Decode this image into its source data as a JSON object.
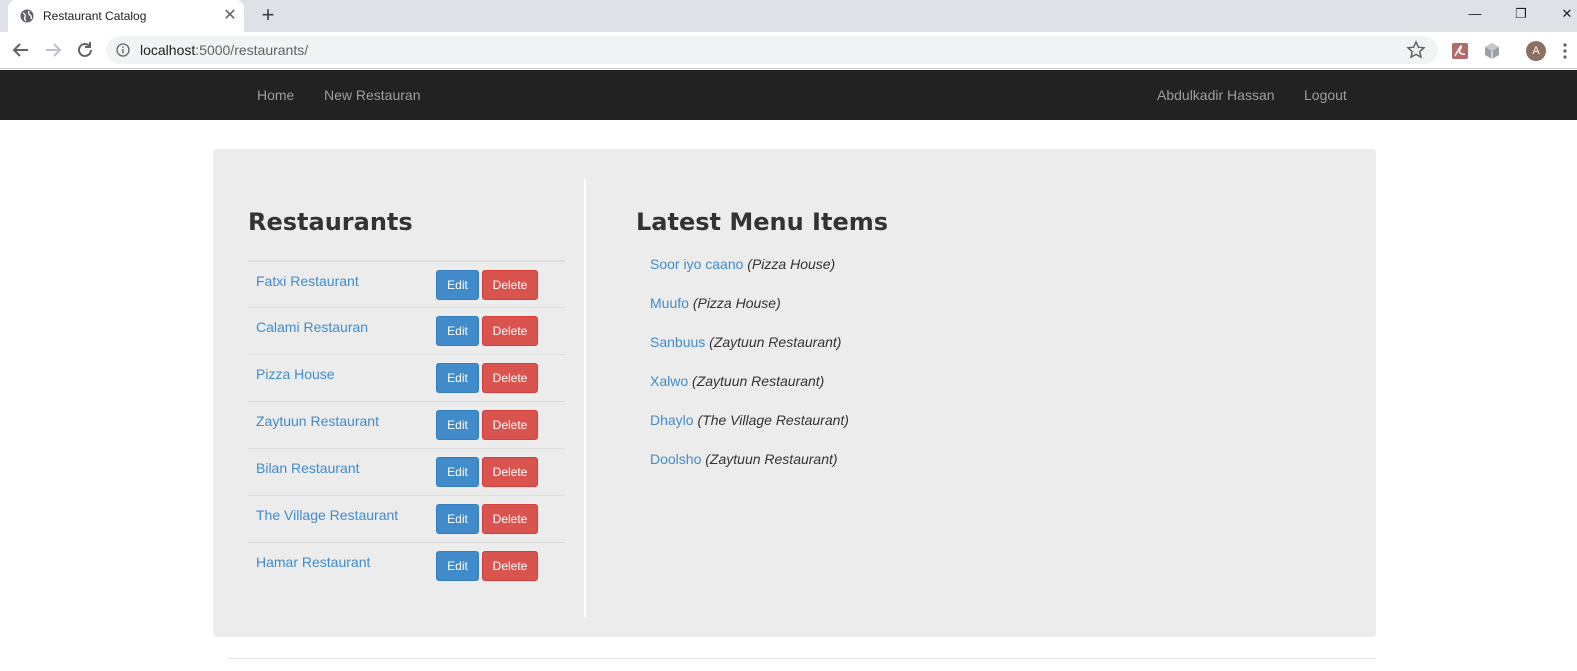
{
  "browser": {
    "tab_title": "Restaurant Catalog",
    "tab_close": "✕",
    "new_tab": "+",
    "url_host": "localhost",
    "url_path": ":5000/restaurants/",
    "profile_initial": "A",
    "window_controls": {
      "minimize": "—",
      "restore": "❐",
      "close": "✕"
    },
    "icons": [
      "globe-icon",
      "back-icon",
      "forward-icon",
      "reload-icon",
      "info-icon",
      "star-icon",
      "pdf-extension-icon",
      "cube-extension-icon",
      "menu-dots-icon"
    ]
  },
  "navbar": {
    "home": "Home",
    "new_restaurant": "New Restauran",
    "user_name": "Abdulkadir Hassan",
    "logout": "Logout"
  },
  "restaurants": {
    "title": "Restaurants",
    "edit_label": "Edit",
    "delete_label": "Delete",
    "items": [
      "Fatxi Restaurant",
      "Calami Restauran",
      "Pizza House",
      "Zaytuun Restaurant",
      "Bilan Restaurant",
      "The Village Restaurant",
      "Hamar Restaurant"
    ]
  },
  "latest": {
    "title": "Latest Menu Items",
    "items": [
      {
        "name": "Soor iyo caano",
        "restaurant": "(Pizza House)"
      },
      {
        "name": "Muufo",
        "restaurant": "(Pizza House)"
      },
      {
        "name": "Sanbuus",
        "restaurant": "(Zaytuun Restaurant)"
      },
      {
        "name": "Xalwo",
        "restaurant": "(Zaytuun Restaurant)"
      },
      {
        "name": "Dhaylo",
        "restaurant": "(The Village Restaurant)"
      },
      {
        "name": "Doolsho",
        "restaurant": "(Zaytuun Restaurant)"
      }
    ]
  },
  "colors": {
    "navbar_bg": "#222222",
    "link": "#428bca",
    "edit_button": "#428bca",
    "delete_button": "#d9534f",
    "panel_bg": "#ececec"
  }
}
